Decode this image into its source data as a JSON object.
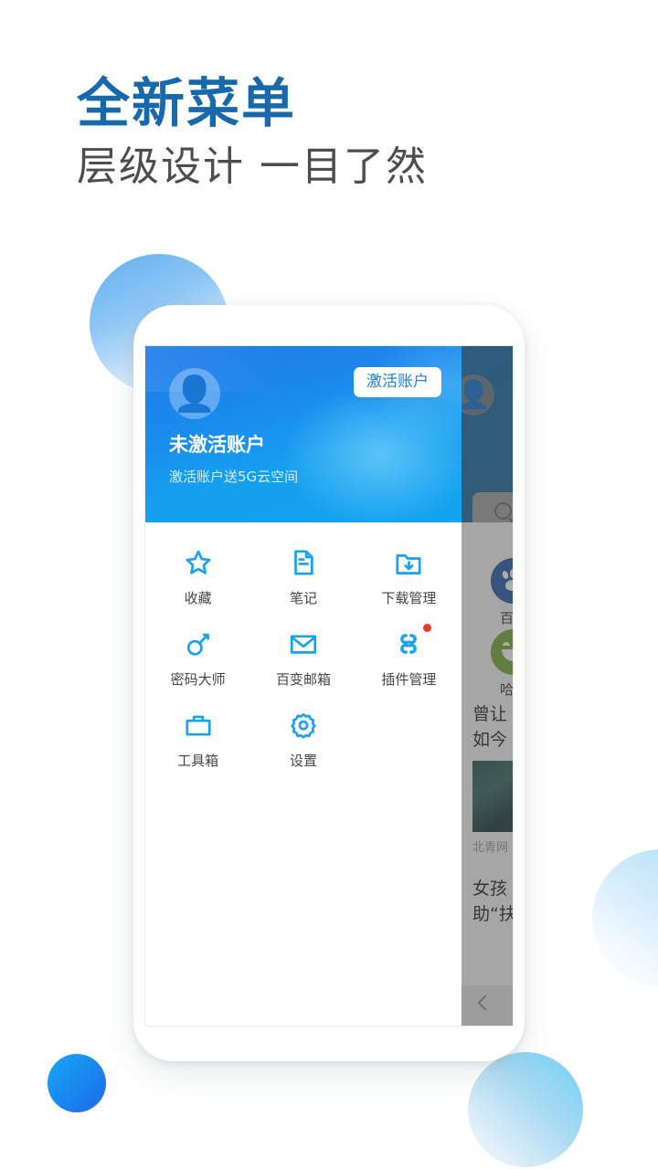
{
  "poster": {
    "headline": "全新菜单",
    "subheadline": "层级设计 一目了然",
    "headline_color": "#1769ac",
    "subheadline_color": "#4d4d4d",
    "background_color": "#ffffff"
  },
  "phone": {
    "menu": {
      "accent_color": "#14a3ef",
      "header": {
        "avatar_icon": "user-avatar-icon",
        "username": "未激活账户",
        "subtitle": "激活账户送5G云空间",
        "activate_button": "激活账户",
        "activate_button_text_color": "#1e82e8"
      },
      "items": [
        {
          "label": "收藏",
          "icon": "star-icon",
          "badge": false
        },
        {
          "label": "笔记",
          "icon": "note-document-icon",
          "badge": false
        },
        {
          "label": "下载管理",
          "icon": "folder-download-icon",
          "badge": false
        },
        {
          "label": "密码大师",
          "icon": "key-icon",
          "badge": false
        },
        {
          "label": "百变邮箱",
          "icon": "envelope-icon",
          "badge": false
        },
        {
          "label": "插件管理",
          "icon": "plugin-clover-icon",
          "badge": true,
          "badge_color": "#f5342a"
        },
        {
          "label": "工具箱",
          "icon": "toolbox-icon",
          "badge": false
        },
        {
          "label": "设置",
          "icon": "gear-icon",
          "badge": false
        }
      ]
    },
    "background_page": {
      "avatar_icon": "user-avatar-icon",
      "search_icon": "search-icon",
      "shortcuts": [
        {
          "label": "百度",
          "icon": "baidu-paw-icon",
          "color": "#2d5faa"
        },
        {
          "label": "哈哈",
          "icon": "smiley-face-icon",
          "color": "#7aa83c"
        }
      ],
      "news": [
        {
          "headline_line1": "曾让",
          "headline_line2": "如今",
          "source": "北青网",
          "thumbnail": "news-photo"
        },
        {
          "headline_line1": "女孩",
          "headline_line2": "助“扶"
        }
      ],
      "back_icon": "chevron-left-icon"
    }
  }
}
